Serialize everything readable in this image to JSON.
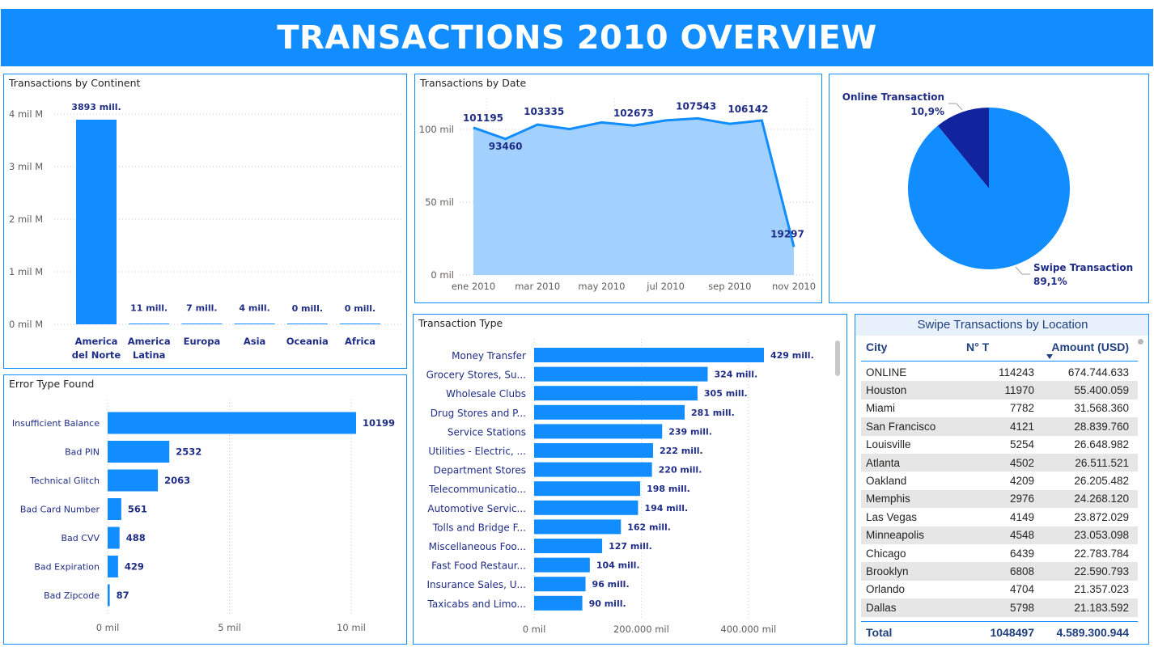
{
  "header": {
    "title": "TRANSACTIONS 2010 OVERVIEW"
  },
  "colors": {
    "accent": "#118DFF",
    "dark_blue": "#12239E",
    "area_fill": "#A3D1FF",
    "label_dark": "#1F2D86"
  },
  "continent_chart": {
    "panel_title": "Transactions by Continent",
    "chart_data": {
      "type": "bar",
      "categories": [
        "America del Norte",
        "America Latina",
        "Europa",
        "Asia",
        "Oceania",
        "Africa"
      ],
      "category_lines": [
        [
          "America",
          "del Norte"
        ],
        [
          "America",
          "Latina"
        ],
        [
          "Europa"
        ],
        [
          "Asia"
        ],
        [
          "Oceania"
        ],
        [
          "Africa"
        ]
      ],
      "values": [
        3893,
        11,
        7,
        4,
        0,
        0
      ],
      "data_labels": [
        "3893 mill.",
        "11 mill.",
        "7 mill.",
        "4 mill.",
        "0 mill.",
        "0 mill."
      ],
      "y_ticks": [
        0,
        1000,
        2000,
        3000,
        4000
      ],
      "y_tick_labels": [
        "0 mil M",
        "1 mil M",
        "2 mil M",
        "3 mil M",
        "4 mil M"
      ],
      "ylim": [
        0,
        4000
      ],
      "grid": true
    }
  },
  "date_chart": {
    "panel_title": "Transactions by Date",
    "chart_data": {
      "type": "area",
      "x": [
        "2010-01",
        "2010-02",
        "2010-03",
        "2010-04",
        "2010-05",
        "2010-06",
        "2010-07",
        "2010-08",
        "2010-09",
        "2010-10",
        "2010-11"
      ],
      "values": [
        101195,
        93460,
        103335,
        100200,
        104800,
        102673,
        106200,
        107543,
        103800,
        106142,
        19297
      ],
      "labeled_points": [
        {
          "x": "2010-01",
          "label": "101195"
        },
        {
          "x": "2010-02",
          "label": "93460"
        },
        {
          "x": "2010-03",
          "label": "103335"
        },
        {
          "x": "2010-06",
          "label": "102673"
        },
        {
          "x": "2010-08",
          "label": "107543"
        },
        {
          "x": "2010-10",
          "label": "106142"
        },
        {
          "x": "2010-11",
          "label": "19297"
        }
      ],
      "x_tick_labels": [
        "ene 2010",
        "mar 2010",
        "may 2010",
        "jul 2010",
        "sep 2010",
        "nov 2010"
      ],
      "x_tick_positions": [
        "2010-01",
        "2010-03",
        "2010-05",
        "2010-07",
        "2010-09",
        "2010-11"
      ],
      "y_ticks": [
        0,
        50000,
        100000
      ],
      "y_tick_labels": [
        "0 mil",
        "50 mil",
        "100 mil"
      ],
      "ylim": [
        0,
        120000
      ],
      "grid": true
    }
  },
  "pie_chart": {
    "chart_data": {
      "type": "pie",
      "slices": [
        {
          "name": "Online Transaction",
          "value": 10.9,
          "label": "10,9%"
        },
        {
          "name": "Swipe Transaction",
          "value": 89.1,
          "label": "89,1%"
        }
      ]
    }
  },
  "error_chart": {
    "panel_title": "Error Type Found",
    "chart_data": {
      "type": "bar",
      "orientation": "horizontal",
      "categories": [
        "Insufficient Balance",
        "Bad PIN",
        "Technical Glitch",
        "Bad Card Number",
        "Bad CVV",
        "Bad Expiration",
        "Bad Zipcode"
      ],
      "values": [
        10199,
        2532,
        2063,
        561,
        488,
        429,
        87
      ],
      "data_labels": [
        "10199",
        "2532",
        "2063",
        "561",
        "488",
        "429",
        "87"
      ],
      "x_ticks": [
        0,
        5000,
        10000
      ],
      "x_tick_labels": [
        "0 mil",
        "5 mil",
        "10 mil"
      ],
      "xlim": [
        0,
        11500
      ],
      "grid": true
    }
  },
  "type_chart": {
    "panel_title": "Transaction Type",
    "chart_data": {
      "type": "bar",
      "orientation": "horizontal",
      "categories": [
        "Money Transfer",
        "Grocery Stores, Su...",
        "Wholesale Clubs",
        "Drug Stores and P...",
        "Service Stations",
        "Utilities - Electric, ...",
        "Department Stores",
        "Telecommunicatio...",
        "Automotive Servic...",
        "Tolls and Bridge F...",
        "Miscellaneous Foo...",
        "Fast Food Restaur...",
        "Insurance Sales, U...",
        "Taxicabs and Limo..."
      ],
      "values": [
        429,
        324,
        305,
        281,
        239,
        222,
        220,
        198,
        194,
        162,
        127,
        104,
        96,
        90
      ],
      "data_labels": [
        "429 mill.",
        "324 mill.",
        "305 mill.",
        "281 mill.",
        "239 mill.",
        "222 mill.",
        "220 mill.",
        "198 mill.",
        "194 mill.",
        "162 mill.",
        "127 mill.",
        "104 mill.",
        "96 mill.",
        "90 mill."
      ],
      "x_ticks": [
        0,
        200,
        400
      ],
      "x_tick_labels": [
        "0 mil",
        "200.000 mil",
        "400.000 mil"
      ],
      "xlim": [
        0,
        480
      ],
      "grid": true
    }
  },
  "location_table": {
    "title": "Swipe Transactions by Location",
    "columns": {
      "city": "City",
      "n": "N° T",
      "amount": "Amount (USD)"
    },
    "sort_icon": "sort-desc-icon",
    "rows": [
      {
        "city": "ONLINE",
        "n": "114243",
        "amount": "674.744.633"
      },
      {
        "city": "Houston",
        "n": "11970",
        "amount": "55.400.059"
      },
      {
        "city": "Miami",
        "n": "7782",
        "amount": "31.568.360"
      },
      {
        "city": "San Francisco",
        "n": "4121",
        "amount": "28.839.760"
      },
      {
        "city": "Louisville",
        "n": "5254",
        "amount": "26.648.982"
      },
      {
        "city": "Atlanta",
        "n": "4502",
        "amount": "26.511.521"
      },
      {
        "city": "Oakland",
        "n": "4209",
        "amount": "26.205.482"
      },
      {
        "city": "Memphis",
        "n": "2976",
        "amount": "24.268.120"
      },
      {
        "city": "Las Vegas",
        "n": "4149",
        "amount": "23.872.029"
      },
      {
        "city": "Minneapolis",
        "n": "4548",
        "amount": "23.053.098"
      },
      {
        "city": "Chicago",
        "n": "6439",
        "amount": "22.783.784"
      },
      {
        "city": "Brooklyn",
        "n": "6808",
        "amount": "22.590.793"
      },
      {
        "city": "Orlando",
        "n": "4704",
        "amount": "21.357.023"
      },
      {
        "city": "Dallas",
        "n": "5798",
        "amount": "21.183.592"
      }
    ],
    "total": {
      "label": "Total",
      "n": "1048497",
      "amount": "4.589.300.944"
    }
  }
}
